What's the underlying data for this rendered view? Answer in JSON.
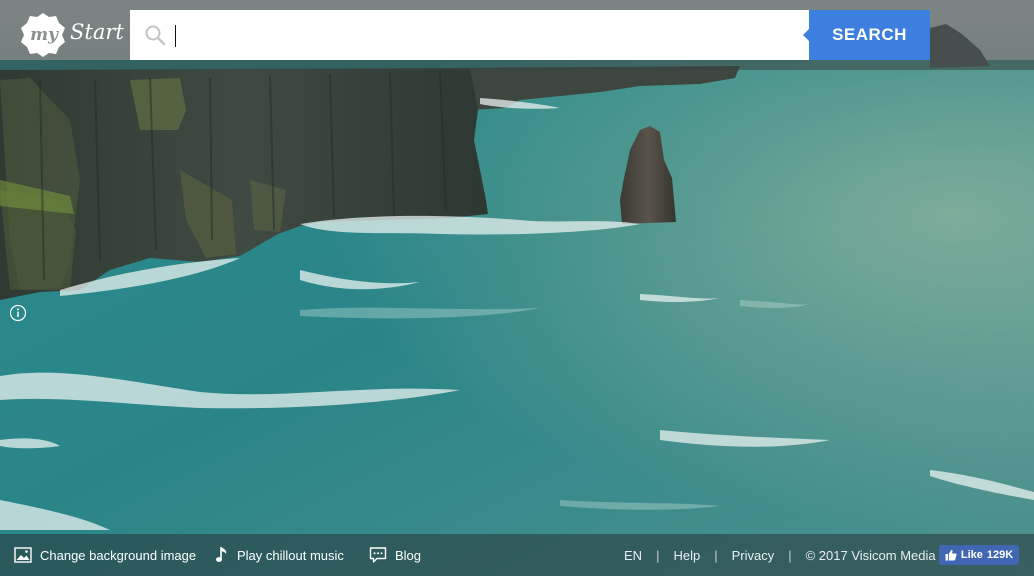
{
  "logo": {
    "my": "my",
    "start": "Start"
  },
  "search": {
    "value": "",
    "placeholder": "",
    "button_label": "SEARCH"
  },
  "footer": {
    "change_background": "Change background image",
    "play_music": "Play chillout music",
    "blog": "Blog",
    "language": "EN",
    "help": "Help",
    "privacy": "Privacy",
    "copyright": "© 2017 Visicom Media",
    "fb_like_label": "Like",
    "fb_like_count": "129K"
  },
  "icons": {
    "search": "search-icon",
    "info": "info-icon",
    "image": "image-icon",
    "music": "music-note-icon",
    "blog": "speech-bubble-icon",
    "thumbs_up": "thumbs-up-icon"
  },
  "colors": {
    "accent": "#3d7fde",
    "facebook": "#4267b2",
    "sea": "#2f8a8c"
  }
}
